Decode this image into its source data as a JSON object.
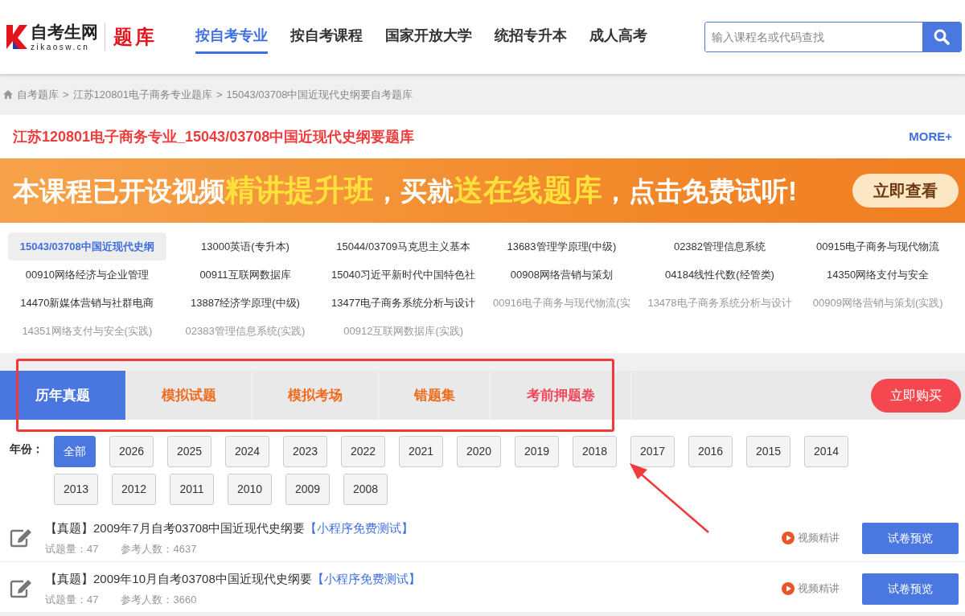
{
  "header": {
    "logo": {
      "name": "自考生网",
      "domain": "zikaosw.cn",
      "section": "题库"
    },
    "nav": [
      {
        "label": "按自考专业",
        "selected": true
      },
      {
        "label": "按自考课程",
        "selected": false
      },
      {
        "label": "国家开放大学",
        "selected": false
      },
      {
        "label": "统招专升本",
        "selected": false
      },
      {
        "label": "成人高考",
        "selected": false
      }
    ],
    "search": {
      "placeholder": "输入课程名或代码查找"
    }
  },
  "breadcrumb": [
    {
      "label": "自考题库",
      "separator": ">"
    },
    {
      "label": "江苏120801电子商务专业题库",
      "separator": ">"
    },
    {
      "label": "15043/03708中国近现代史纲要自考题库"
    }
  ],
  "title": {
    "text": "江苏120801电子商务专业_15043/03708中国近现代史纲要题库",
    "more": "MORE+"
  },
  "banner": {
    "segments": [
      {
        "text": "本课程已开设视频",
        "highlight": false
      },
      {
        "text": "精讲提升班",
        "highlight": true
      },
      {
        "text": "，买就",
        "highlight": false
      },
      {
        "text": "送在线题库",
        "highlight": true
      },
      {
        "text": "，点击免费试听!",
        "highlight": false
      }
    ],
    "button": "立即查看"
  },
  "courses": [
    {
      "label": "15043/03708中国近现代史纲",
      "kind": "exam",
      "selected": true
    },
    {
      "label": "13000英语(专升本)",
      "kind": "exam",
      "selected": false
    },
    {
      "label": "15044/03709马克思主义基本",
      "kind": "exam",
      "selected": false
    },
    {
      "label": "13683管理学原理(中级)",
      "kind": "exam",
      "selected": false
    },
    {
      "label": "02382管理信息系统",
      "kind": "exam",
      "selected": false
    },
    {
      "label": "00915电子商务与现代物流",
      "kind": "exam",
      "selected": false
    },
    {
      "label": "00910网络经济与企业管理",
      "kind": "exam",
      "selected": false
    },
    {
      "label": "00911互联网数据库",
      "kind": "exam",
      "selected": false
    },
    {
      "label": "15040习近平新时代中国特色社",
      "kind": "exam",
      "selected": false
    },
    {
      "label": "00908网络营销与策划",
      "kind": "exam",
      "selected": false
    },
    {
      "label": "04184线性代数(经管类)",
      "kind": "exam",
      "selected": false
    },
    {
      "label": "14350网络支付与安全",
      "kind": "exam",
      "selected": false
    },
    {
      "label": "14470新媒体营销与社群电商",
      "kind": "exam",
      "selected": false
    },
    {
      "label": "13887经济学原理(中级)",
      "kind": "exam",
      "selected": false
    },
    {
      "label": "13477电子商务系统分析与设计",
      "kind": "exam",
      "selected": false
    },
    {
      "label": "00916电子商务与现代物流(实",
      "kind": "practice",
      "selected": false
    },
    {
      "label": "13478电子商务系统分析与设计",
      "kind": "practice",
      "selected": false
    },
    {
      "label": "00909网络营销与策划(实践)",
      "kind": "practice",
      "selected": false
    },
    {
      "label": "14351网络支付与安全(实践)",
      "kind": "practice",
      "selected": false
    },
    {
      "label": "02383管理信息系统(实践)",
      "kind": "practice",
      "selected": false
    },
    {
      "label": "00912互联网数据库(实践)",
      "kind": "practice",
      "selected": false
    }
  ],
  "tabs": [
    {
      "label": "历年真题",
      "kind": "normal",
      "selected": true
    },
    {
      "label": "模拟试题",
      "kind": "normal",
      "selected": false
    },
    {
      "label": "模拟考场",
      "kind": "normal",
      "selected": false
    },
    {
      "label": "错题集",
      "kind": "normal",
      "selected": false
    },
    {
      "label": "考前押题卷",
      "kind": "hot",
      "selected": false
    }
  ],
  "buy_button": "立即购买",
  "years": {
    "label": "年份：",
    "options": [
      {
        "label": "全部",
        "selected": true
      },
      {
        "label": "2026",
        "selected": false
      },
      {
        "label": "2025",
        "selected": false
      },
      {
        "label": "2024",
        "selected": false
      },
      {
        "label": "2023",
        "selected": false
      },
      {
        "label": "2022",
        "selected": false
      },
      {
        "label": "2021",
        "selected": false
      },
      {
        "label": "2020",
        "selected": false
      },
      {
        "label": "2019",
        "selected": false
      },
      {
        "label": "2018",
        "selected": false
      },
      {
        "label": "2017",
        "selected": false
      },
      {
        "label": "2016",
        "selected": false
      },
      {
        "label": "2015",
        "selected": false
      },
      {
        "label": "2014",
        "selected": false
      },
      {
        "label": "2013",
        "selected": false
      },
      {
        "label": "2012",
        "selected": false
      },
      {
        "label": "2011",
        "selected": false
      },
      {
        "label": "2010",
        "selected": false
      },
      {
        "label": "2009",
        "selected": false
      },
      {
        "label": "2008",
        "selected": false
      }
    ]
  },
  "papers": [
    {
      "title": "【真题】2009年7月自考03708中国近现代史纲要",
      "link": "【小程序免费测试】",
      "count": "试题量：47",
      "participants": "参考人数：4637",
      "video": "视频精讲",
      "button": "试卷预览"
    },
    {
      "title": "【真题】2009年10月自考03708中国近现代史纲要",
      "link": "【小程序免费测试】",
      "count": "试题量：47",
      "participants": "参考人数：3660",
      "video": "视频精讲",
      "button": "试卷预览"
    }
  ]
}
